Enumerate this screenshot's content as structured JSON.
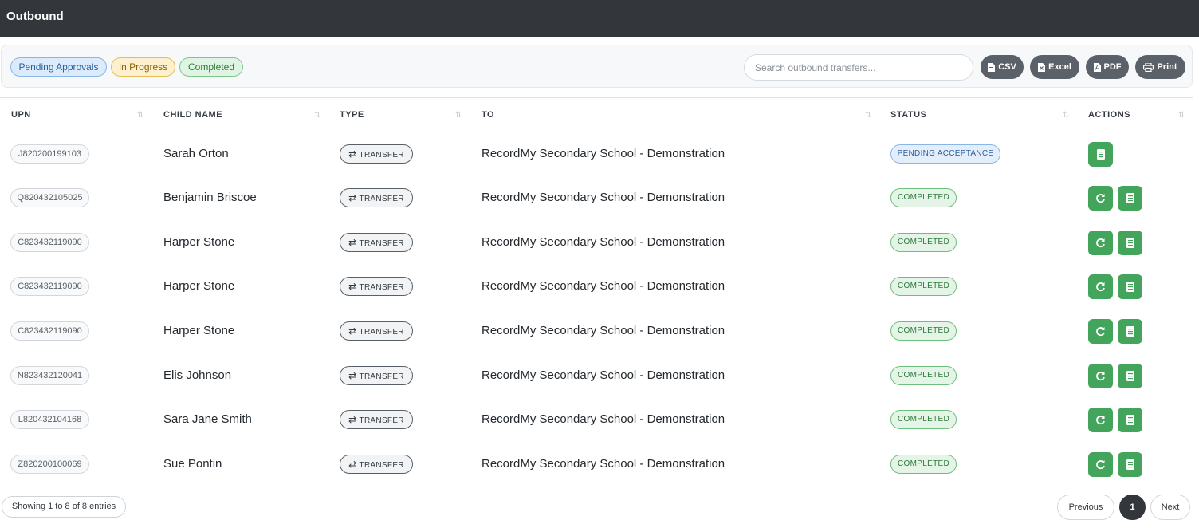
{
  "header": {
    "title": "Outbound"
  },
  "filters": {
    "pending_label": "Pending Approvals",
    "progress_label": "In Progress",
    "completed_label": "Completed"
  },
  "search": {
    "placeholder": "Search outbound transfers...",
    "value": ""
  },
  "exports": {
    "csv": "CSV",
    "excel": "Excel",
    "pdf": "PDF",
    "print": "Print"
  },
  "table": {
    "columns": [
      "UPN",
      "CHILD NAME",
      "TYPE",
      "TO",
      "STATUS",
      "ACTIONS"
    ],
    "type_icon": "exchange-arrows-icon",
    "rows": [
      {
        "upn": "J820200199103",
        "name": "Sarah Orton",
        "type": "TRANSFER",
        "to": "RecordMy Secondary School - Demonstration",
        "status": "PENDING ACCEPTANCE"
      },
      {
        "upn": "Q820432105025",
        "name": "Benjamin Briscoe",
        "type": "TRANSFER",
        "to": "RecordMy Secondary School - Demonstration",
        "status": "COMPLETED"
      },
      {
        "upn": "C823432119090",
        "name": "Harper Stone",
        "type": "TRANSFER",
        "to": "RecordMy Secondary School - Demonstration",
        "status": "COMPLETED"
      },
      {
        "upn": "C823432119090",
        "name": "Harper Stone",
        "type": "TRANSFER",
        "to": "RecordMy Secondary School - Demonstration",
        "status": "COMPLETED"
      },
      {
        "upn": "C823432119090",
        "name": "Harper Stone",
        "type": "TRANSFER",
        "to": "RecordMy Secondary School - Demonstration",
        "status": "COMPLETED"
      },
      {
        "upn": "N823432120041",
        "name": "Elis Johnson",
        "type": "TRANSFER",
        "to": "RecordMy Secondary School - Demonstration",
        "status": "COMPLETED"
      },
      {
        "upn": "L820432104168",
        "name": "Sara Jane Smith",
        "type": "TRANSFER",
        "to": "RecordMy Secondary School - Demonstration",
        "status": "COMPLETED"
      },
      {
        "upn": "Z820200100069",
        "name": "Sue Pontin",
        "type": "TRANSFER",
        "to": "RecordMy Secondary School - Demonstration",
        "status": "COMPLETED"
      }
    ]
  },
  "footer": {
    "info": "Showing 1 to 8 of 8 entries",
    "previous": "Previous",
    "page": "1",
    "next": "Next"
  },
  "colors": {
    "header_bg": "#33373c",
    "action_green": "#43a55b",
    "export_btn": "#5b6168"
  }
}
